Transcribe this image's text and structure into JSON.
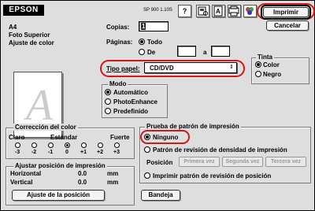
{
  "header": {
    "brand": "EPSON",
    "model": "SP 900 1.10S",
    "help_glyph": "?"
  },
  "buttons": {
    "print": "Imprimir",
    "cancel": "Cancelar",
    "tray": "Bandeja"
  },
  "summary": {
    "paper_size": "A4",
    "media_type": "Foto Superior",
    "color_adjust": "Ajuste de color"
  },
  "preview": {
    "glyph": "A"
  },
  "copies": {
    "label": "Copias:",
    "value": "1"
  },
  "pages": {
    "label": "Páginas:",
    "all_label": "Todo",
    "from_label": "De",
    "to_label": "a"
  },
  "paper_type": {
    "label": "Tipo papel:",
    "value": "CD/DVD",
    "arrow_glyph": "⇕"
  },
  "ink": {
    "title": "Tinta",
    "color": "Color",
    "black": "Negro",
    "selected": "Color"
  },
  "mode": {
    "title": "Modo",
    "automatic": "Automático",
    "photoenhance": "PhotoEnhance",
    "predefined": "Predefinido",
    "selected": "Automático"
  },
  "color_correction": {
    "title": "Corrección del color",
    "low": "Claro",
    "mid": "Estándar",
    "high": "Fuerte",
    "ticks": [
      "-3",
      "-2",
      "-1",
      "0",
      "+1",
      "+2",
      "+3"
    ],
    "selected": "0"
  },
  "position": {
    "title": "Ajustar posición de impresión",
    "horizontal_label": "Horizontal",
    "horizontal_value": "0.0",
    "vertical_label": "Vertical",
    "vertical_value": "0.0",
    "unit": "mm",
    "button": "Ajuste de la posición"
  },
  "pattern": {
    "title": "Prueba de patrón de impresión",
    "none": "Ninguno",
    "density": "Patrón de revisión de densidad de impresión",
    "position_label": "Posición",
    "first": "Primera vez",
    "second": "Segunda vez",
    "third": "Tercera vez",
    "print_position": "Imprimir patrón de revisión de posición",
    "selected": "Ninguno"
  },
  "colors": {
    "highlight": "#d01818",
    "background": "#dedede"
  }
}
